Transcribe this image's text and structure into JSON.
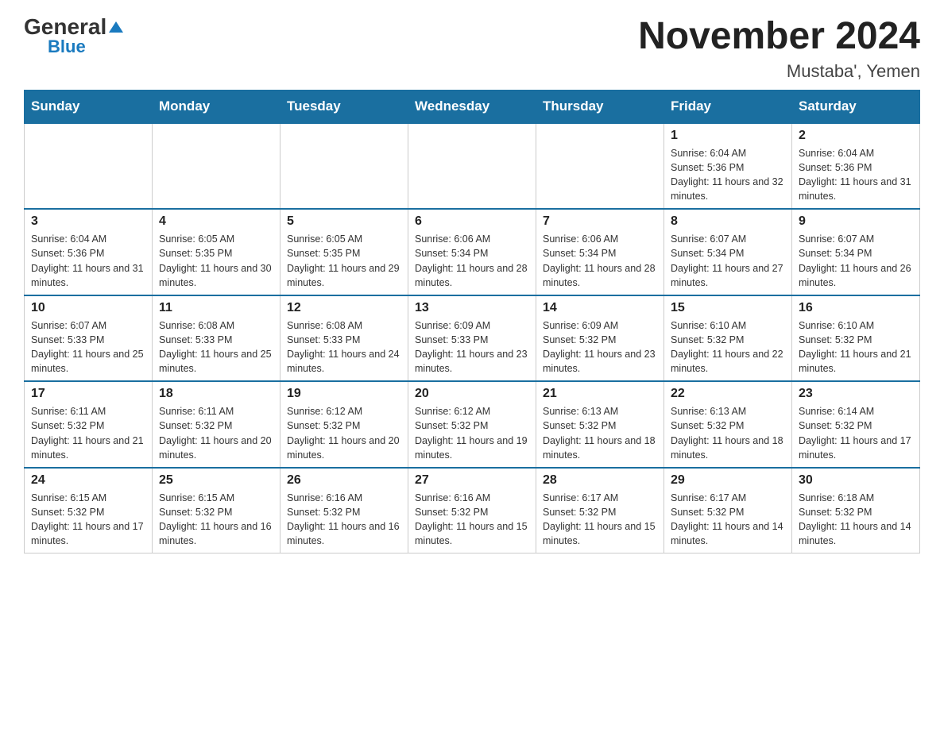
{
  "header": {
    "logo_general": "General",
    "logo_blue": "Blue",
    "month_title": "November 2024",
    "location": "Mustaba', Yemen"
  },
  "weekdays": [
    "Sunday",
    "Monday",
    "Tuesday",
    "Wednesday",
    "Thursday",
    "Friday",
    "Saturday"
  ],
  "weeks": [
    [
      {
        "day": "",
        "info": ""
      },
      {
        "day": "",
        "info": ""
      },
      {
        "day": "",
        "info": ""
      },
      {
        "day": "",
        "info": ""
      },
      {
        "day": "",
        "info": ""
      },
      {
        "day": "1",
        "info": "Sunrise: 6:04 AM\nSunset: 5:36 PM\nDaylight: 11 hours and 32 minutes."
      },
      {
        "day": "2",
        "info": "Sunrise: 6:04 AM\nSunset: 5:36 PM\nDaylight: 11 hours and 31 minutes."
      }
    ],
    [
      {
        "day": "3",
        "info": "Sunrise: 6:04 AM\nSunset: 5:36 PM\nDaylight: 11 hours and 31 minutes."
      },
      {
        "day": "4",
        "info": "Sunrise: 6:05 AM\nSunset: 5:35 PM\nDaylight: 11 hours and 30 minutes."
      },
      {
        "day": "5",
        "info": "Sunrise: 6:05 AM\nSunset: 5:35 PM\nDaylight: 11 hours and 29 minutes."
      },
      {
        "day": "6",
        "info": "Sunrise: 6:06 AM\nSunset: 5:34 PM\nDaylight: 11 hours and 28 minutes."
      },
      {
        "day": "7",
        "info": "Sunrise: 6:06 AM\nSunset: 5:34 PM\nDaylight: 11 hours and 28 minutes."
      },
      {
        "day": "8",
        "info": "Sunrise: 6:07 AM\nSunset: 5:34 PM\nDaylight: 11 hours and 27 minutes."
      },
      {
        "day": "9",
        "info": "Sunrise: 6:07 AM\nSunset: 5:34 PM\nDaylight: 11 hours and 26 minutes."
      }
    ],
    [
      {
        "day": "10",
        "info": "Sunrise: 6:07 AM\nSunset: 5:33 PM\nDaylight: 11 hours and 25 minutes."
      },
      {
        "day": "11",
        "info": "Sunrise: 6:08 AM\nSunset: 5:33 PM\nDaylight: 11 hours and 25 minutes."
      },
      {
        "day": "12",
        "info": "Sunrise: 6:08 AM\nSunset: 5:33 PM\nDaylight: 11 hours and 24 minutes."
      },
      {
        "day": "13",
        "info": "Sunrise: 6:09 AM\nSunset: 5:33 PM\nDaylight: 11 hours and 23 minutes."
      },
      {
        "day": "14",
        "info": "Sunrise: 6:09 AM\nSunset: 5:32 PM\nDaylight: 11 hours and 23 minutes."
      },
      {
        "day": "15",
        "info": "Sunrise: 6:10 AM\nSunset: 5:32 PM\nDaylight: 11 hours and 22 minutes."
      },
      {
        "day": "16",
        "info": "Sunrise: 6:10 AM\nSunset: 5:32 PM\nDaylight: 11 hours and 21 minutes."
      }
    ],
    [
      {
        "day": "17",
        "info": "Sunrise: 6:11 AM\nSunset: 5:32 PM\nDaylight: 11 hours and 21 minutes."
      },
      {
        "day": "18",
        "info": "Sunrise: 6:11 AM\nSunset: 5:32 PM\nDaylight: 11 hours and 20 minutes."
      },
      {
        "day": "19",
        "info": "Sunrise: 6:12 AM\nSunset: 5:32 PM\nDaylight: 11 hours and 20 minutes."
      },
      {
        "day": "20",
        "info": "Sunrise: 6:12 AM\nSunset: 5:32 PM\nDaylight: 11 hours and 19 minutes."
      },
      {
        "day": "21",
        "info": "Sunrise: 6:13 AM\nSunset: 5:32 PM\nDaylight: 11 hours and 18 minutes."
      },
      {
        "day": "22",
        "info": "Sunrise: 6:13 AM\nSunset: 5:32 PM\nDaylight: 11 hours and 18 minutes."
      },
      {
        "day": "23",
        "info": "Sunrise: 6:14 AM\nSunset: 5:32 PM\nDaylight: 11 hours and 17 minutes."
      }
    ],
    [
      {
        "day": "24",
        "info": "Sunrise: 6:15 AM\nSunset: 5:32 PM\nDaylight: 11 hours and 17 minutes."
      },
      {
        "day": "25",
        "info": "Sunrise: 6:15 AM\nSunset: 5:32 PM\nDaylight: 11 hours and 16 minutes."
      },
      {
        "day": "26",
        "info": "Sunrise: 6:16 AM\nSunset: 5:32 PM\nDaylight: 11 hours and 16 minutes."
      },
      {
        "day": "27",
        "info": "Sunrise: 6:16 AM\nSunset: 5:32 PM\nDaylight: 11 hours and 15 minutes."
      },
      {
        "day": "28",
        "info": "Sunrise: 6:17 AM\nSunset: 5:32 PM\nDaylight: 11 hours and 15 minutes."
      },
      {
        "day": "29",
        "info": "Sunrise: 6:17 AM\nSunset: 5:32 PM\nDaylight: 11 hours and 14 minutes."
      },
      {
        "day": "30",
        "info": "Sunrise: 6:18 AM\nSunset: 5:32 PM\nDaylight: 11 hours and 14 minutes."
      }
    ]
  ]
}
